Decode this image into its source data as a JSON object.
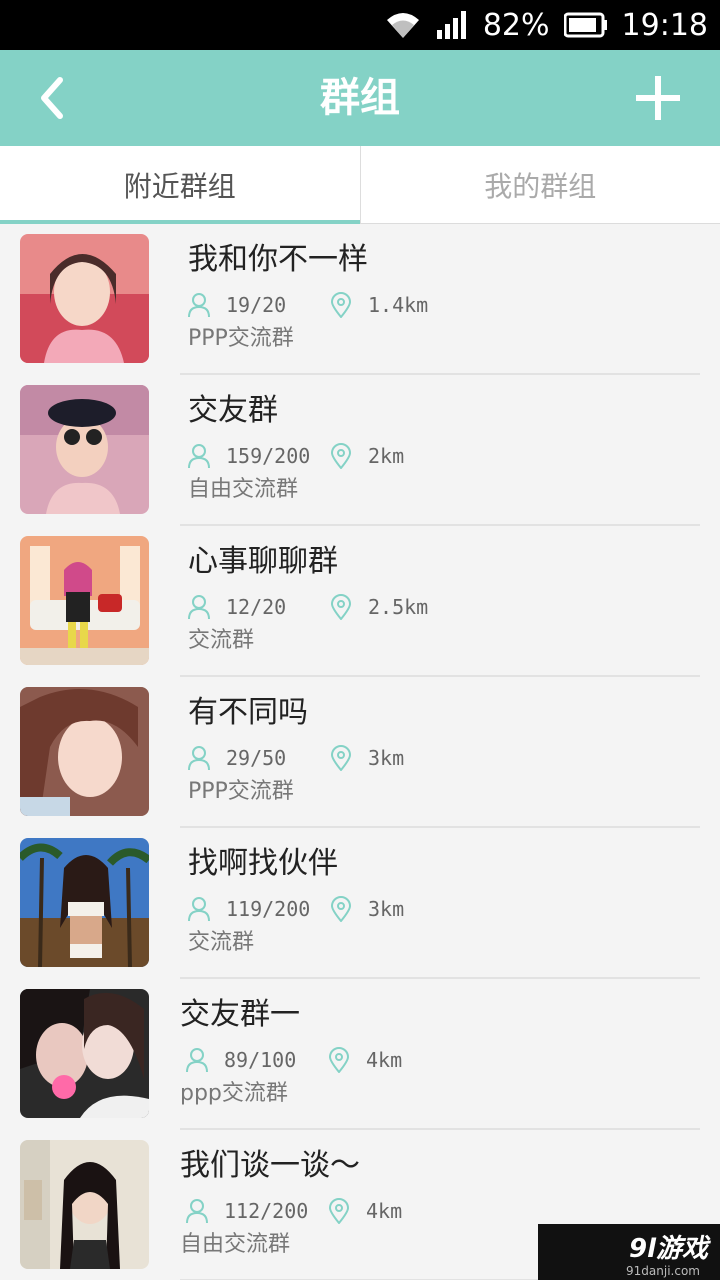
{
  "status_bar": {
    "battery": "82%",
    "time": "19:18"
  },
  "app_bar": {
    "title": "群组"
  },
  "tabs": [
    {
      "label": "附近群组",
      "active": true
    },
    {
      "label": "我的群组",
      "active": false
    }
  ],
  "groups": [
    {
      "name": "我和你不一样",
      "members": "19/20",
      "distance": "1.4km",
      "description": "PPP交流群"
    },
    {
      "name": "交友群",
      "members": "159/200",
      "distance": "2km",
      "description": "自由交流群"
    },
    {
      "name": "心事聊聊群",
      "members": "12/20",
      "distance": "2.5km",
      "description": "交流群"
    },
    {
      "name": "有不同吗",
      "members": "29/50",
      "distance": "3km",
      "description": "PPP交流群"
    },
    {
      "name": "找啊找伙伴",
      "members": "119/200",
      "distance": "3km",
      "description": "交流群"
    },
    {
      "name": "交友群一",
      "members": "89/100",
      "distance": "4km",
      "description": "ppp交流群"
    },
    {
      "name": "我们谈一谈～",
      "members": "112/200",
      "distance": "4km",
      "description": "自由交流群"
    }
  ],
  "watermark": {
    "brand": "9l游戏",
    "site": "91danji.com"
  },
  "colors": {
    "accent": "#84d2c6",
    "status_bar": "#000000",
    "background": "#f4f4f4"
  }
}
